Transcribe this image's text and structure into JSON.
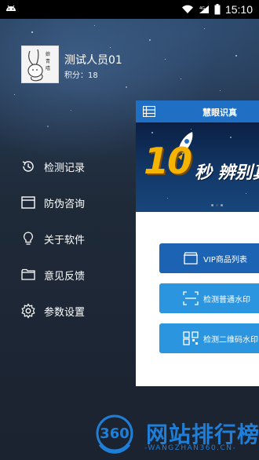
{
  "status_bar": {
    "time": "15:10"
  },
  "profile": {
    "name": "测试人员01",
    "points_label": "积分：",
    "points_value": "18"
  },
  "menu": [
    {
      "label": "检测记录",
      "icon": "history-icon"
    },
    {
      "label": "防伪咨询",
      "icon": "window-icon"
    },
    {
      "label": "关于软件",
      "icon": "lightbulb-icon"
    },
    {
      "label": "意见反馈",
      "icon": "folder-icon"
    },
    {
      "label": "参数设置",
      "icon": "gear-icon"
    }
  ],
  "main": {
    "title": "慧眼识真",
    "banner": {
      "number": "10",
      "text": "秒 辨别真"
    },
    "buttons": [
      {
        "label": "VIP商品列表",
        "icon": "box-icon"
      },
      {
        "label": "检测普通水印",
        "icon": "scan-icon"
      },
      {
        "label": "检测二维码水印",
        "icon": "qr-icon"
      }
    ]
  },
  "watermark": {
    "logo_text": "360",
    "title": "网站排行榜",
    "url": "-WANGZHAN360.CN-"
  },
  "colors": {
    "header_blue": "#1f6fc4",
    "vip_button": "#1d63b3",
    "scan_button": "#2b95df",
    "watermark_blue": "#1f7fd8"
  }
}
